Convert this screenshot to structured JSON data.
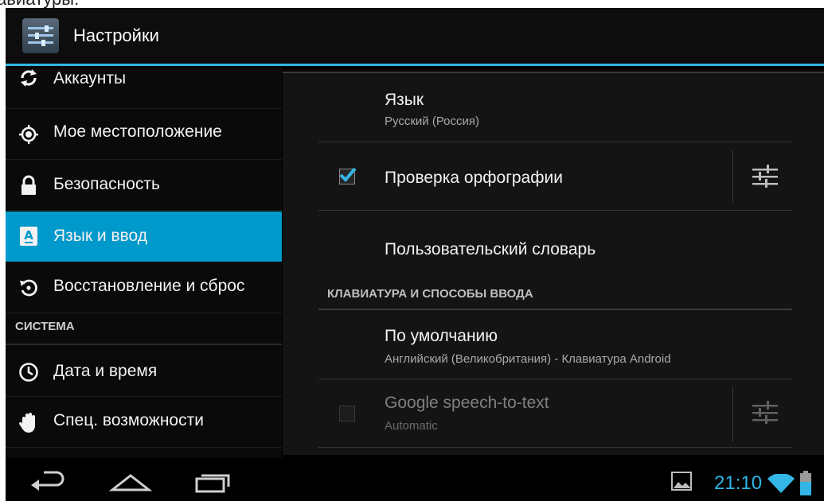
{
  "title_fragment": "авиатуры.",
  "action_bar": {
    "title": "Настройки",
    "app_icon": "settings-sliders-icon"
  },
  "sidebar": {
    "items": [
      {
        "label": "Аккаунты",
        "icon": "sync-icon"
      },
      {
        "label": "Мое местоположение",
        "icon": "location-icon"
      },
      {
        "label": "Безопасность",
        "icon": "lock-icon"
      },
      {
        "label": "Язык и ввод",
        "icon": "keyboard-a-icon",
        "selected": true
      },
      {
        "label": "Восстановление и сброс",
        "icon": "restore-icon"
      }
    ],
    "section_system": "СИСТЕМА",
    "system_items": [
      {
        "label": "Дата и время",
        "icon": "clock-icon"
      },
      {
        "label": "Спец. возможности",
        "icon": "hand-icon"
      }
    ]
  },
  "main": {
    "language": {
      "title": "Язык",
      "summary": "Русский (Россия)"
    },
    "spell_check": {
      "title": "Проверка орфографии",
      "checked": true
    },
    "user_dictionary": {
      "title": "Пользовательский словарь"
    },
    "category": "КЛАВИАТУРА И СПОСОБЫ ВВОДА",
    "default_input": {
      "title": "По умолчанию",
      "summary": "Английский (Великобритания) - Клавиатура Android"
    },
    "google_speech": {
      "title": "Google speech-to-text",
      "summary": "Automatic",
      "checked": false
    }
  },
  "status_bar": {
    "time": "21:10"
  },
  "colors": {
    "accent": "#33b5e5",
    "selected": "#0099cc"
  }
}
